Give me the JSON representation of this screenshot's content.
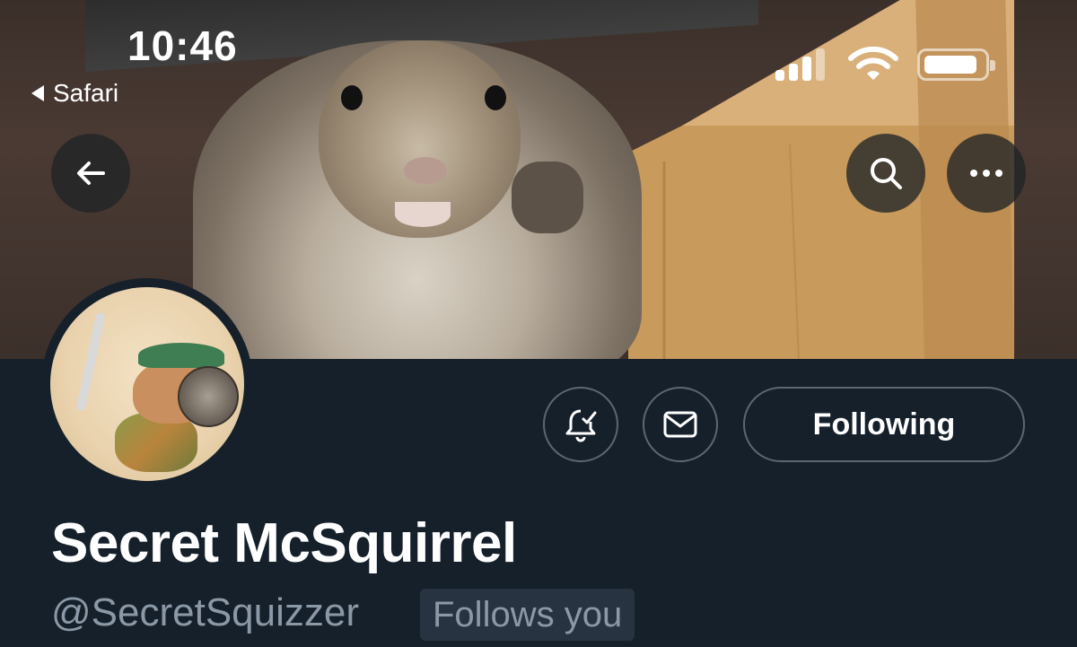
{
  "status_bar": {
    "time": "10:46",
    "back_app": "Safari",
    "signal_icon": "cellular-signal-icon",
    "wifi_icon": "wifi-icon",
    "battery_icon": "battery-icon"
  },
  "nav": {
    "back_icon": "arrow-left-icon",
    "search_icon": "search-icon",
    "more_icon": "ellipsis-icon"
  },
  "profile": {
    "display_name": "Secret McSquirrel",
    "handle": "@SecretSquizzer",
    "follows_you": "Follows you",
    "following_label": "Following",
    "notify_icon": "bell-check-icon",
    "message_icon": "envelope-icon"
  },
  "colors": {
    "background": "#15202b",
    "button_border": "#5d6771",
    "secondary_text": "#8b98a5",
    "badge_bg": "#273340"
  }
}
